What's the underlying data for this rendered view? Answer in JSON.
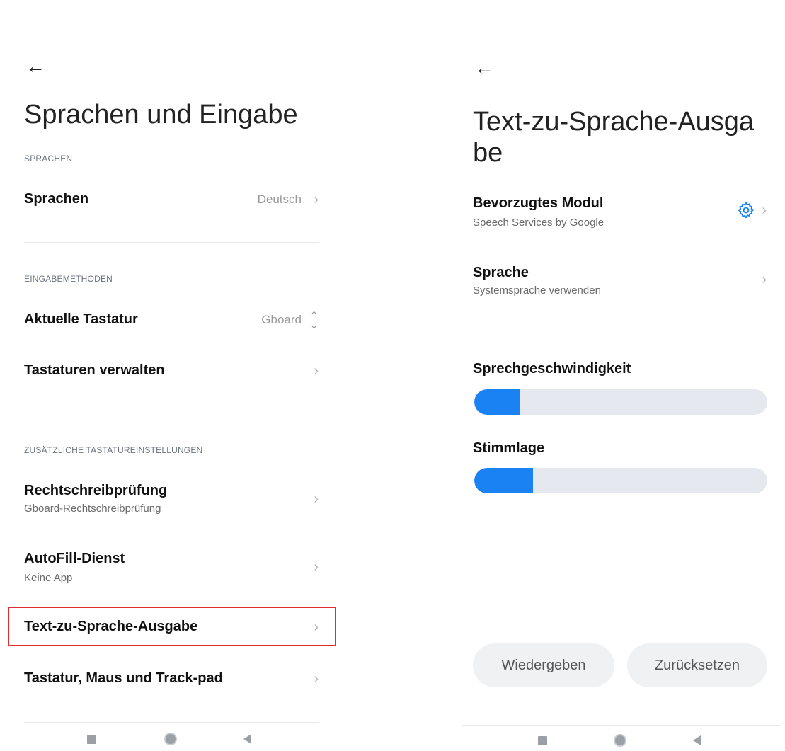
{
  "left": {
    "title": "Sprachen und Eingabe",
    "sections": {
      "languages": "SPRACHEN",
      "input_methods": "EINGABEMETHODEN",
      "extra": "ZUSÄTZLICHE TASTATUREINSTELLUNGEN"
    },
    "items": {
      "sprachen": {
        "title": "Sprachen",
        "value": "Deutsch"
      },
      "tastatur": {
        "title": "Aktuelle Tastatur",
        "value": "Gboard"
      },
      "verwalten": {
        "title": "Tastaturen verwalten"
      },
      "rechtschreib": {
        "title": "Rechtschreibprüfung",
        "subtitle": "Gboard-Rechtschreibprüfung"
      },
      "autofill": {
        "title": "AutoFill-Dienst",
        "subtitle": "Keine App"
      },
      "tts": {
        "title": "Text-zu-Sprache-Ausgabe"
      },
      "maus": {
        "title": "Tastatur, Maus und Track-pad"
      }
    }
  },
  "right": {
    "title": "Text-zu-Sprache-Ausga be",
    "items": {
      "modul": {
        "title": "Bevorzugtes Modul",
        "subtitle": "Speech Services by Google"
      },
      "sprache": {
        "title": "Sprache",
        "subtitle": "Systemsprache verwenden"
      }
    },
    "speech_rate": {
      "label": "Sprechgeschwindigkeit",
      "level": 0.155
    },
    "pitch": {
      "label": "Stimmlage",
      "level": 0.2
    },
    "buttons": {
      "play": "Wiedergeben",
      "reset": "Zurücksetzen"
    }
  },
  "icons": {
    "back": "back-arrow-icon",
    "chevron": "chevron-right-icon",
    "settings": "gear-icon",
    "updown": "up-down-chevron-icon"
  },
  "colors": {
    "accent": "#1a82f2",
    "highlight": "#e02d2d"
  }
}
